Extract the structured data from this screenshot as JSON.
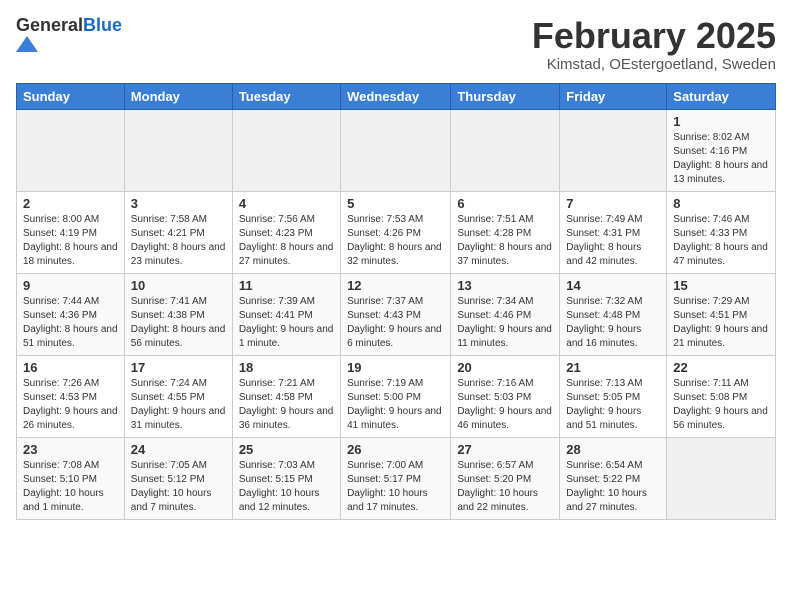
{
  "header": {
    "logo_general": "General",
    "logo_blue": "Blue",
    "month_title": "February 2025",
    "location": "Kimstad, OEstergoetland, Sweden"
  },
  "weekdays": [
    "Sunday",
    "Monday",
    "Tuesday",
    "Wednesday",
    "Thursday",
    "Friday",
    "Saturday"
  ],
  "weeks": [
    [
      {
        "day": "",
        "info": ""
      },
      {
        "day": "",
        "info": ""
      },
      {
        "day": "",
        "info": ""
      },
      {
        "day": "",
        "info": ""
      },
      {
        "day": "",
        "info": ""
      },
      {
        "day": "",
        "info": ""
      },
      {
        "day": "1",
        "info": "Sunrise: 8:02 AM\nSunset: 4:16 PM\nDaylight: 8 hours and 13 minutes."
      }
    ],
    [
      {
        "day": "2",
        "info": "Sunrise: 8:00 AM\nSunset: 4:19 PM\nDaylight: 8 hours and 18 minutes."
      },
      {
        "day": "3",
        "info": "Sunrise: 7:58 AM\nSunset: 4:21 PM\nDaylight: 8 hours and 23 minutes."
      },
      {
        "day": "4",
        "info": "Sunrise: 7:56 AM\nSunset: 4:23 PM\nDaylight: 8 hours and 27 minutes."
      },
      {
        "day": "5",
        "info": "Sunrise: 7:53 AM\nSunset: 4:26 PM\nDaylight: 8 hours and 32 minutes."
      },
      {
        "day": "6",
        "info": "Sunrise: 7:51 AM\nSunset: 4:28 PM\nDaylight: 8 hours and 37 minutes."
      },
      {
        "day": "7",
        "info": "Sunrise: 7:49 AM\nSunset: 4:31 PM\nDaylight: 8 hours and 42 minutes."
      },
      {
        "day": "8",
        "info": "Sunrise: 7:46 AM\nSunset: 4:33 PM\nDaylight: 8 hours and 47 minutes."
      }
    ],
    [
      {
        "day": "9",
        "info": "Sunrise: 7:44 AM\nSunset: 4:36 PM\nDaylight: 8 hours and 51 minutes."
      },
      {
        "day": "10",
        "info": "Sunrise: 7:41 AM\nSunset: 4:38 PM\nDaylight: 8 hours and 56 minutes."
      },
      {
        "day": "11",
        "info": "Sunrise: 7:39 AM\nSunset: 4:41 PM\nDaylight: 9 hours and 1 minute."
      },
      {
        "day": "12",
        "info": "Sunrise: 7:37 AM\nSunset: 4:43 PM\nDaylight: 9 hours and 6 minutes."
      },
      {
        "day": "13",
        "info": "Sunrise: 7:34 AM\nSunset: 4:46 PM\nDaylight: 9 hours and 11 minutes."
      },
      {
        "day": "14",
        "info": "Sunrise: 7:32 AM\nSunset: 4:48 PM\nDaylight: 9 hours and 16 minutes."
      },
      {
        "day": "15",
        "info": "Sunrise: 7:29 AM\nSunset: 4:51 PM\nDaylight: 9 hours and 21 minutes."
      }
    ],
    [
      {
        "day": "16",
        "info": "Sunrise: 7:26 AM\nSunset: 4:53 PM\nDaylight: 9 hours and 26 minutes."
      },
      {
        "day": "17",
        "info": "Sunrise: 7:24 AM\nSunset: 4:55 PM\nDaylight: 9 hours and 31 minutes."
      },
      {
        "day": "18",
        "info": "Sunrise: 7:21 AM\nSunset: 4:58 PM\nDaylight: 9 hours and 36 minutes."
      },
      {
        "day": "19",
        "info": "Sunrise: 7:19 AM\nSunset: 5:00 PM\nDaylight: 9 hours and 41 minutes."
      },
      {
        "day": "20",
        "info": "Sunrise: 7:16 AM\nSunset: 5:03 PM\nDaylight: 9 hours and 46 minutes."
      },
      {
        "day": "21",
        "info": "Sunrise: 7:13 AM\nSunset: 5:05 PM\nDaylight: 9 hours and 51 minutes."
      },
      {
        "day": "22",
        "info": "Sunrise: 7:11 AM\nSunset: 5:08 PM\nDaylight: 9 hours and 56 minutes."
      }
    ],
    [
      {
        "day": "23",
        "info": "Sunrise: 7:08 AM\nSunset: 5:10 PM\nDaylight: 10 hours and 1 minute."
      },
      {
        "day": "24",
        "info": "Sunrise: 7:05 AM\nSunset: 5:12 PM\nDaylight: 10 hours and 7 minutes."
      },
      {
        "day": "25",
        "info": "Sunrise: 7:03 AM\nSunset: 5:15 PM\nDaylight: 10 hours and 12 minutes."
      },
      {
        "day": "26",
        "info": "Sunrise: 7:00 AM\nSunset: 5:17 PM\nDaylight: 10 hours and 17 minutes."
      },
      {
        "day": "27",
        "info": "Sunrise: 6:57 AM\nSunset: 5:20 PM\nDaylight: 10 hours and 22 minutes."
      },
      {
        "day": "28",
        "info": "Sunrise: 6:54 AM\nSunset: 5:22 PM\nDaylight: 10 hours and 27 minutes."
      },
      {
        "day": "",
        "info": ""
      }
    ]
  ]
}
